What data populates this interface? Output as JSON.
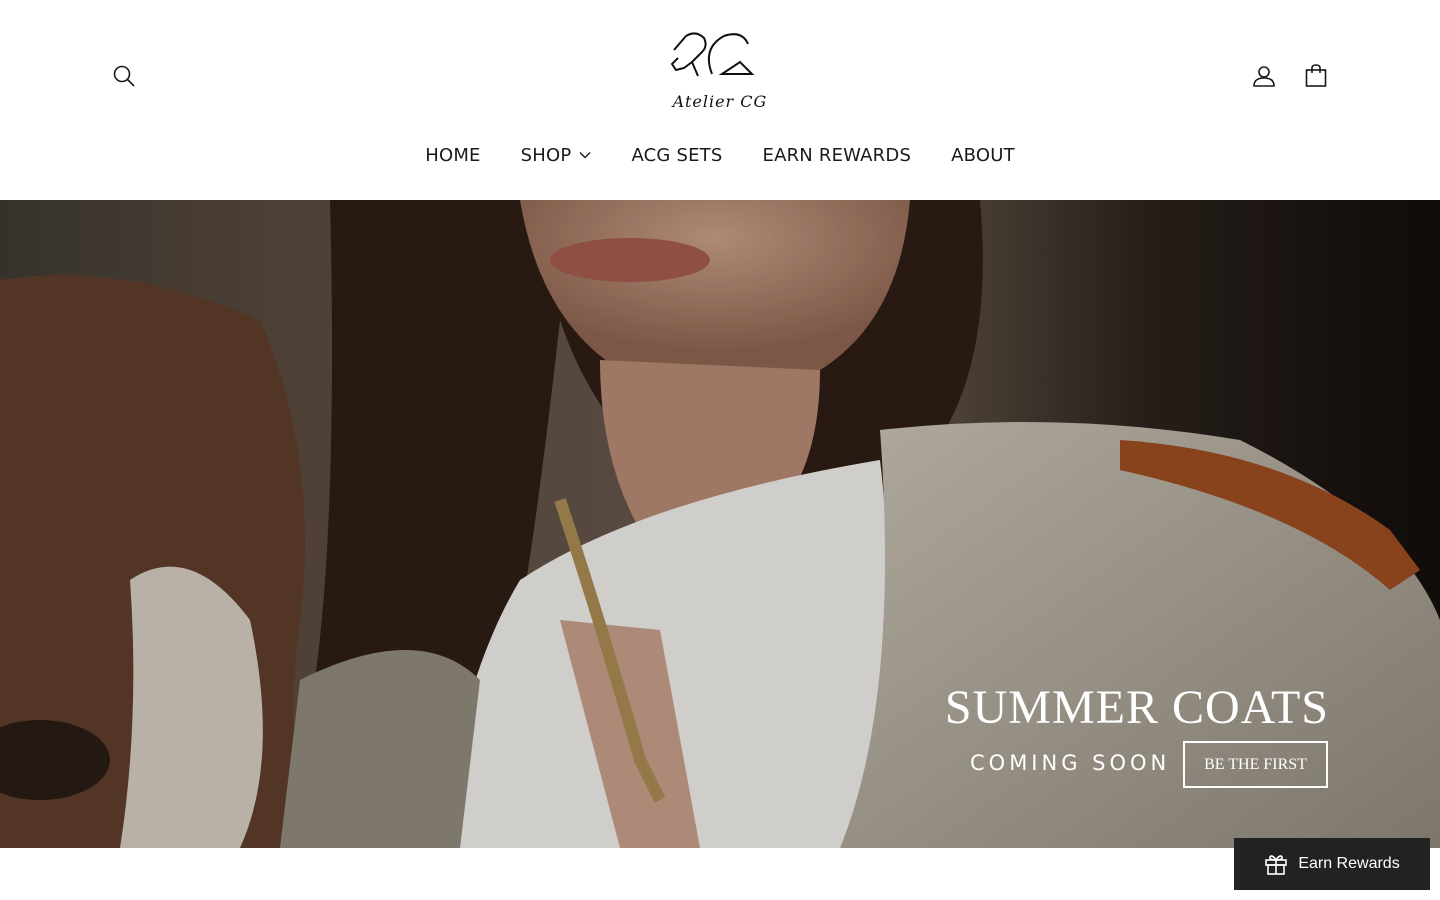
{
  "header": {
    "logo_text": "Atelier CG",
    "nav": [
      {
        "label": "HOME"
      },
      {
        "label": "SHOP"
      },
      {
        "label": "ACG SETS"
      },
      {
        "label": "EARN REWARDS"
      },
      {
        "label": "ABOUT"
      }
    ],
    "icons": {
      "search": "search-icon",
      "account": "user-icon",
      "cart": "bag-icon",
      "shop_dropdown": "chevron-down-icon"
    }
  },
  "hero": {
    "title": "SUMMER COATS",
    "subtitle": "COMING SOON",
    "button_label": "BE THE FIRST"
  },
  "rewards_widget": {
    "label": "Earn Rewards",
    "icon": "gift-icon"
  },
  "colors": {
    "text": "#1a1a1a",
    "hero_text": "#ffffff",
    "rewards_bg": "#222222"
  }
}
